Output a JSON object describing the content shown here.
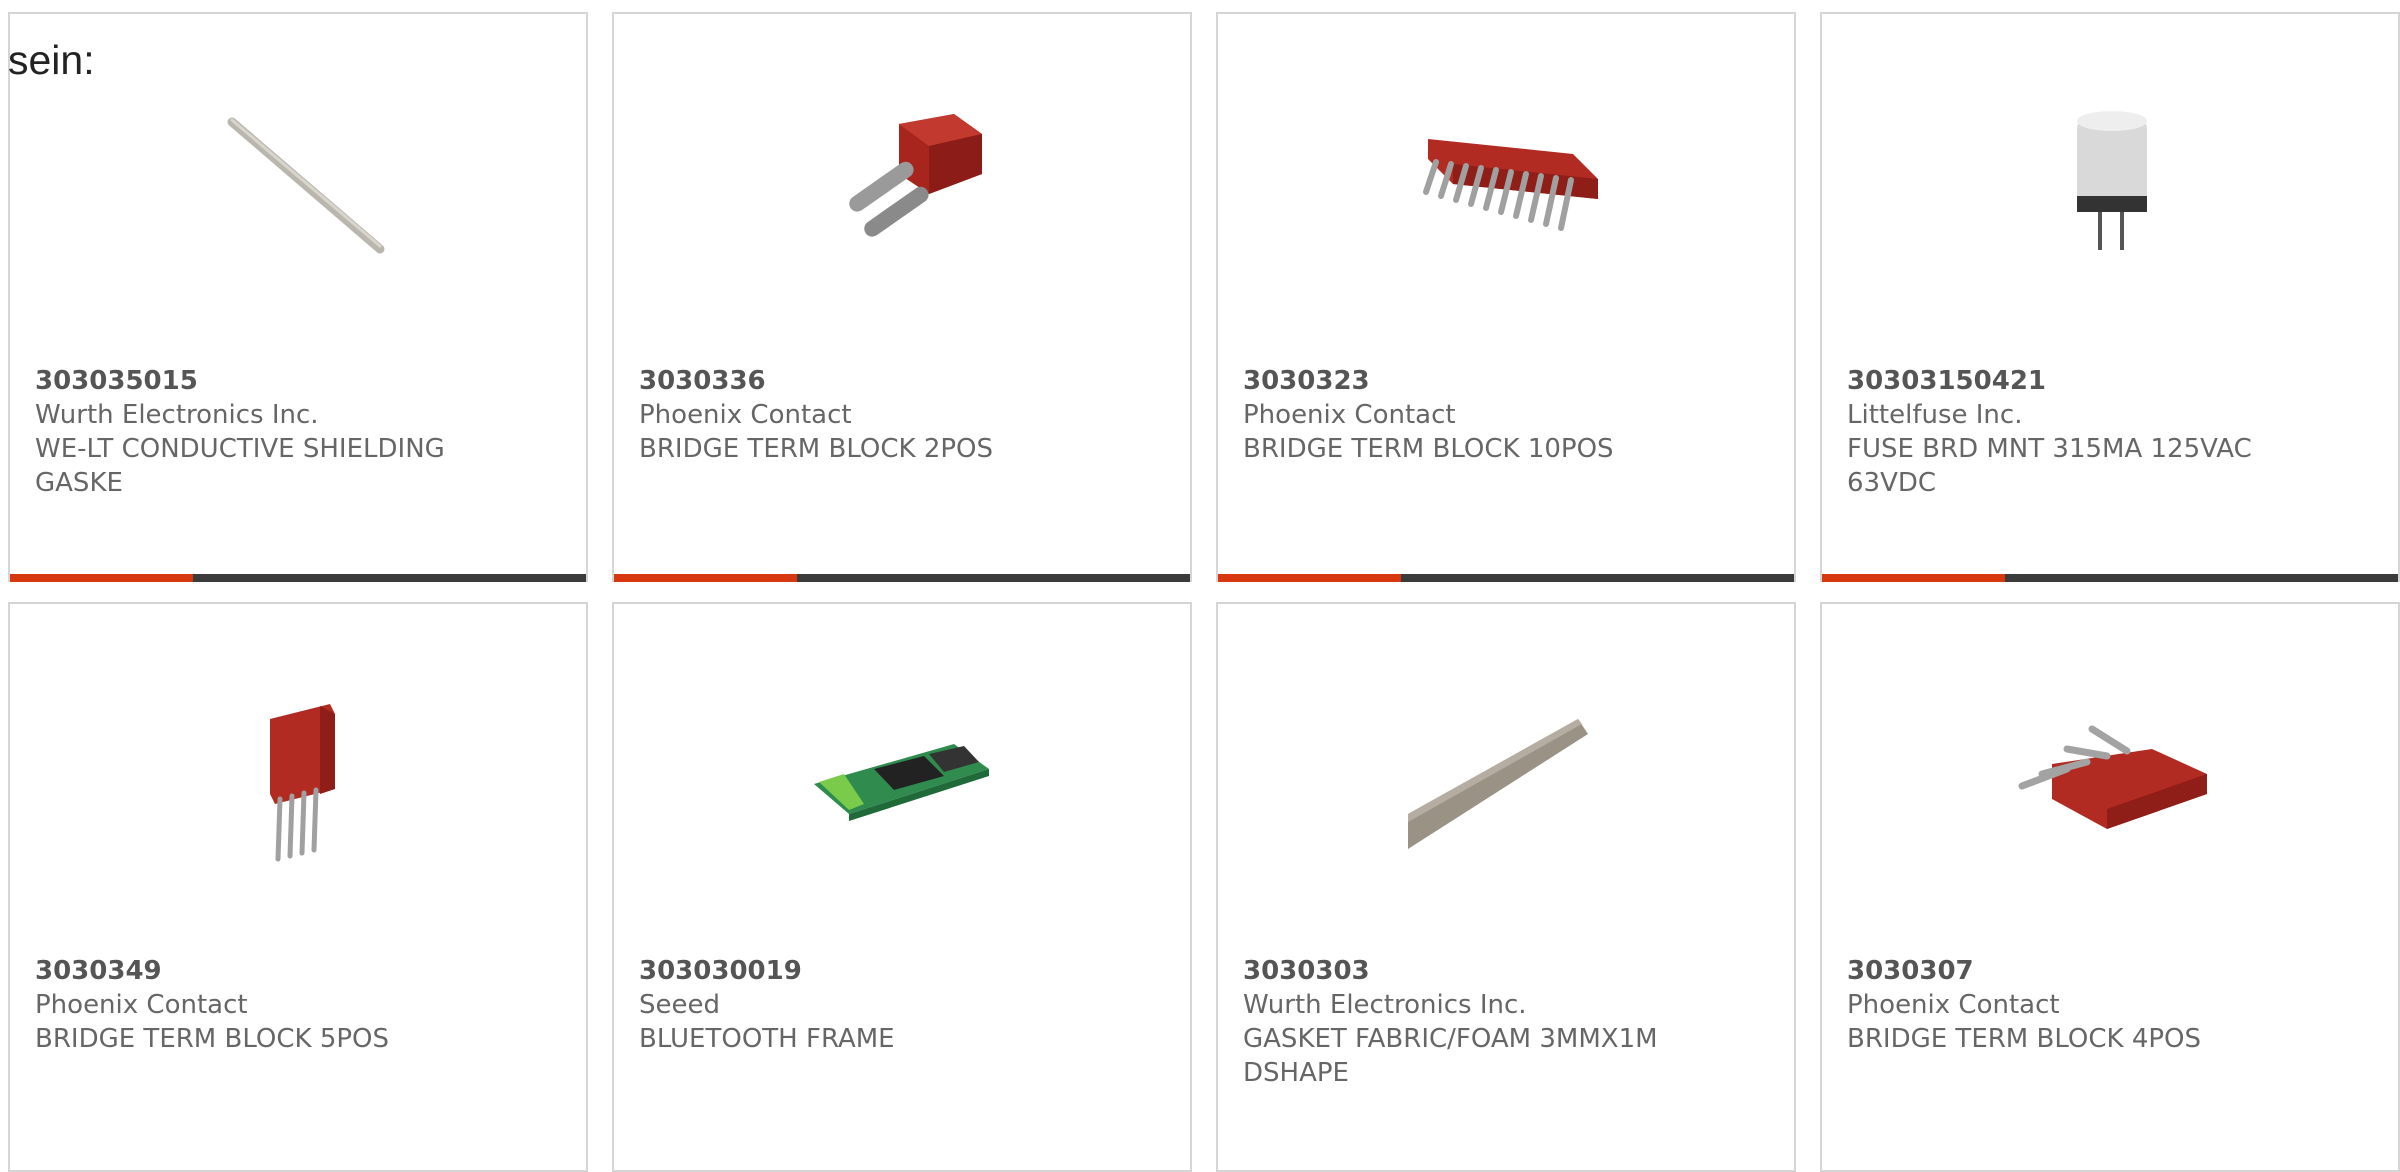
{
  "intro_text": "sein:",
  "products": [
    {
      "part_number": "303035015",
      "manufacturer": "Wurth Electronics Inc.",
      "description": "WE-LT CONDUCTIVE SHIELDING GASKE",
      "image_icon": "shielding-gasket-strip-icon"
    },
    {
      "part_number": "3030336",
      "manufacturer": "Phoenix Contact",
      "description": "BRIDGE TERM BLOCK 2POS",
      "image_icon": "bridge-2pos-icon"
    },
    {
      "part_number": "3030323",
      "manufacturer": "Phoenix Contact",
      "description": "BRIDGE TERM BLOCK 10POS",
      "image_icon": "bridge-10pos-icon"
    },
    {
      "part_number": "30303150421",
      "manufacturer": "Littelfuse Inc.",
      "description": "FUSE BRD MNT 315MA 125VAC 63VDC",
      "image_icon": "fuse-icon"
    },
    {
      "part_number": "3030349",
      "manufacturer": "Phoenix Contact",
      "description": "BRIDGE TERM BLOCK 5POS",
      "image_icon": "bridge-5pos-icon"
    },
    {
      "part_number": "303030019",
      "manufacturer": "Seeed",
      "description": "BLUETOOTH FRAME",
      "image_icon": "bluetooth-module-icon"
    },
    {
      "part_number": "3030303",
      "manufacturer": "Wurth Electronics Inc.",
      "description": "GASKET FABRIC/FOAM 3MMX1M DSHAPE",
      "image_icon": "foam-gasket-icon"
    },
    {
      "part_number": "3030307",
      "manufacturer": "Phoenix Contact",
      "description": "BRIDGE TERM BLOCK 4POS",
      "image_icon": "bridge-4pos-icon"
    }
  ],
  "colors": {
    "accent": "#d8380f",
    "bar_dark": "#3b3b3b",
    "border": "#d5d5d5",
    "text": "#666666"
  }
}
